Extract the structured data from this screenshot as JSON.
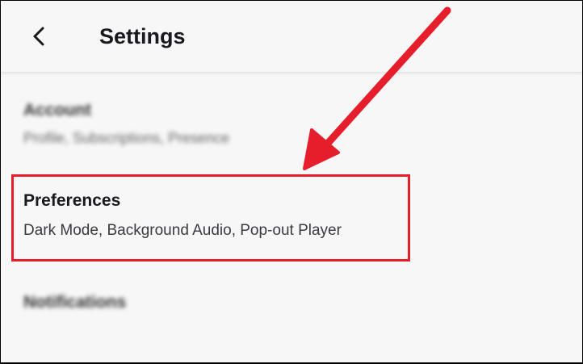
{
  "header": {
    "title": "Settings",
    "back_icon": "chevron-left-icon"
  },
  "settings": {
    "items": [
      {
        "title": "Account",
        "subtitle": "Profile, Subscriptions, Presence",
        "blurred": true
      },
      {
        "title": "Preferences",
        "subtitle": "Dark Mode, Background Audio, Pop-out Player",
        "blurred": false,
        "highlighted": true
      },
      {
        "title": "Notifications",
        "subtitle": "",
        "blurred": true
      }
    ]
  },
  "annotation": {
    "color": "#e61e2b",
    "type": "arrow-and-box"
  }
}
